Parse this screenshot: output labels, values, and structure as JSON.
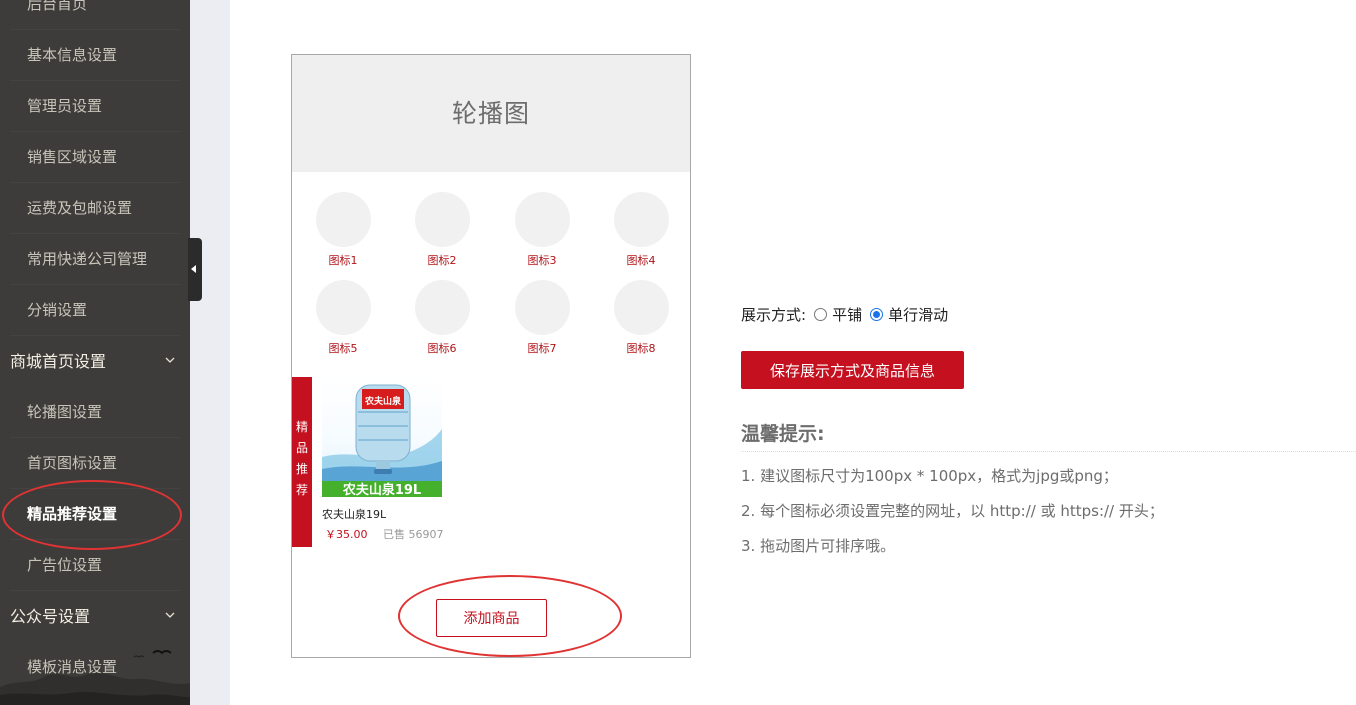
{
  "sidebar": {
    "items": [
      {
        "label": "后台首页"
      },
      {
        "label": "基本信息设置"
      },
      {
        "label": "管理员设置"
      },
      {
        "label": "销售区域设置"
      },
      {
        "label": "运费及包邮设置"
      },
      {
        "label": "常用快递公司管理"
      },
      {
        "label": "分销设置"
      }
    ],
    "group_mall": {
      "label": "商城首页设置",
      "items": [
        {
          "label": "轮播图设置"
        },
        {
          "label": "首页图标设置"
        },
        {
          "label": "精品推荐设置"
        },
        {
          "label": "广告位设置"
        }
      ]
    },
    "group_wechat": {
      "label": "公众号设置",
      "items": [
        {
          "label": "模板消息设置"
        }
      ]
    },
    "active_item": "精品推荐设置",
    "collapse_icon": "triangle-left-icon"
  },
  "preview": {
    "banner_label": "轮播图",
    "icons": [
      {
        "label": "图标1"
      },
      {
        "label": "图标2"
      },
      {
        "label": "图标3"
      },
      {
        "label": "图标4"
      },
      {
        "label": "图标5"
      },
      {
        "label": "图标6"
      },
      {
        "label": "图标7"
      },
      {
        "label": "图标8"
      }
    ],
    "recommend_tag": [
      "精",
      "品",
      "推",
      "荐"
    ],
    "product": {
      "name": "农夫山泉19L",
      "image_caption": "农夫山泉19L",
      "bottle_label": "农夫山泉",
      "price": "￥35.00",
      "sold": "已售 56907"
    },
    "add_button": "添加商品"
  },
  "settings": {
    "display_label": "展示方式:",
    "options": [
      {
        "label": "平铺",
        "checked": false
      },
      {
        "label": "单行滑动",
        "checked": true
      }
    ],
    "save_button": "保存展示方式及商品信息",
    "tips_title": "温馨提示:",
    "tips": [
      "1. 建议图标尺寸为100px * 100px，格式为jpg或png；",
      "2. 每个图标必须设置完整的网址，以 http:// 或 https:// 开头；",
      "3. 拖动图片可排序哦。"
    ]
  },
  "colors": {
    "accent": "#c4101f",
    "sidebar_bg": "#3d3c3a",
    "annotation": "#e03333"
  }
}
